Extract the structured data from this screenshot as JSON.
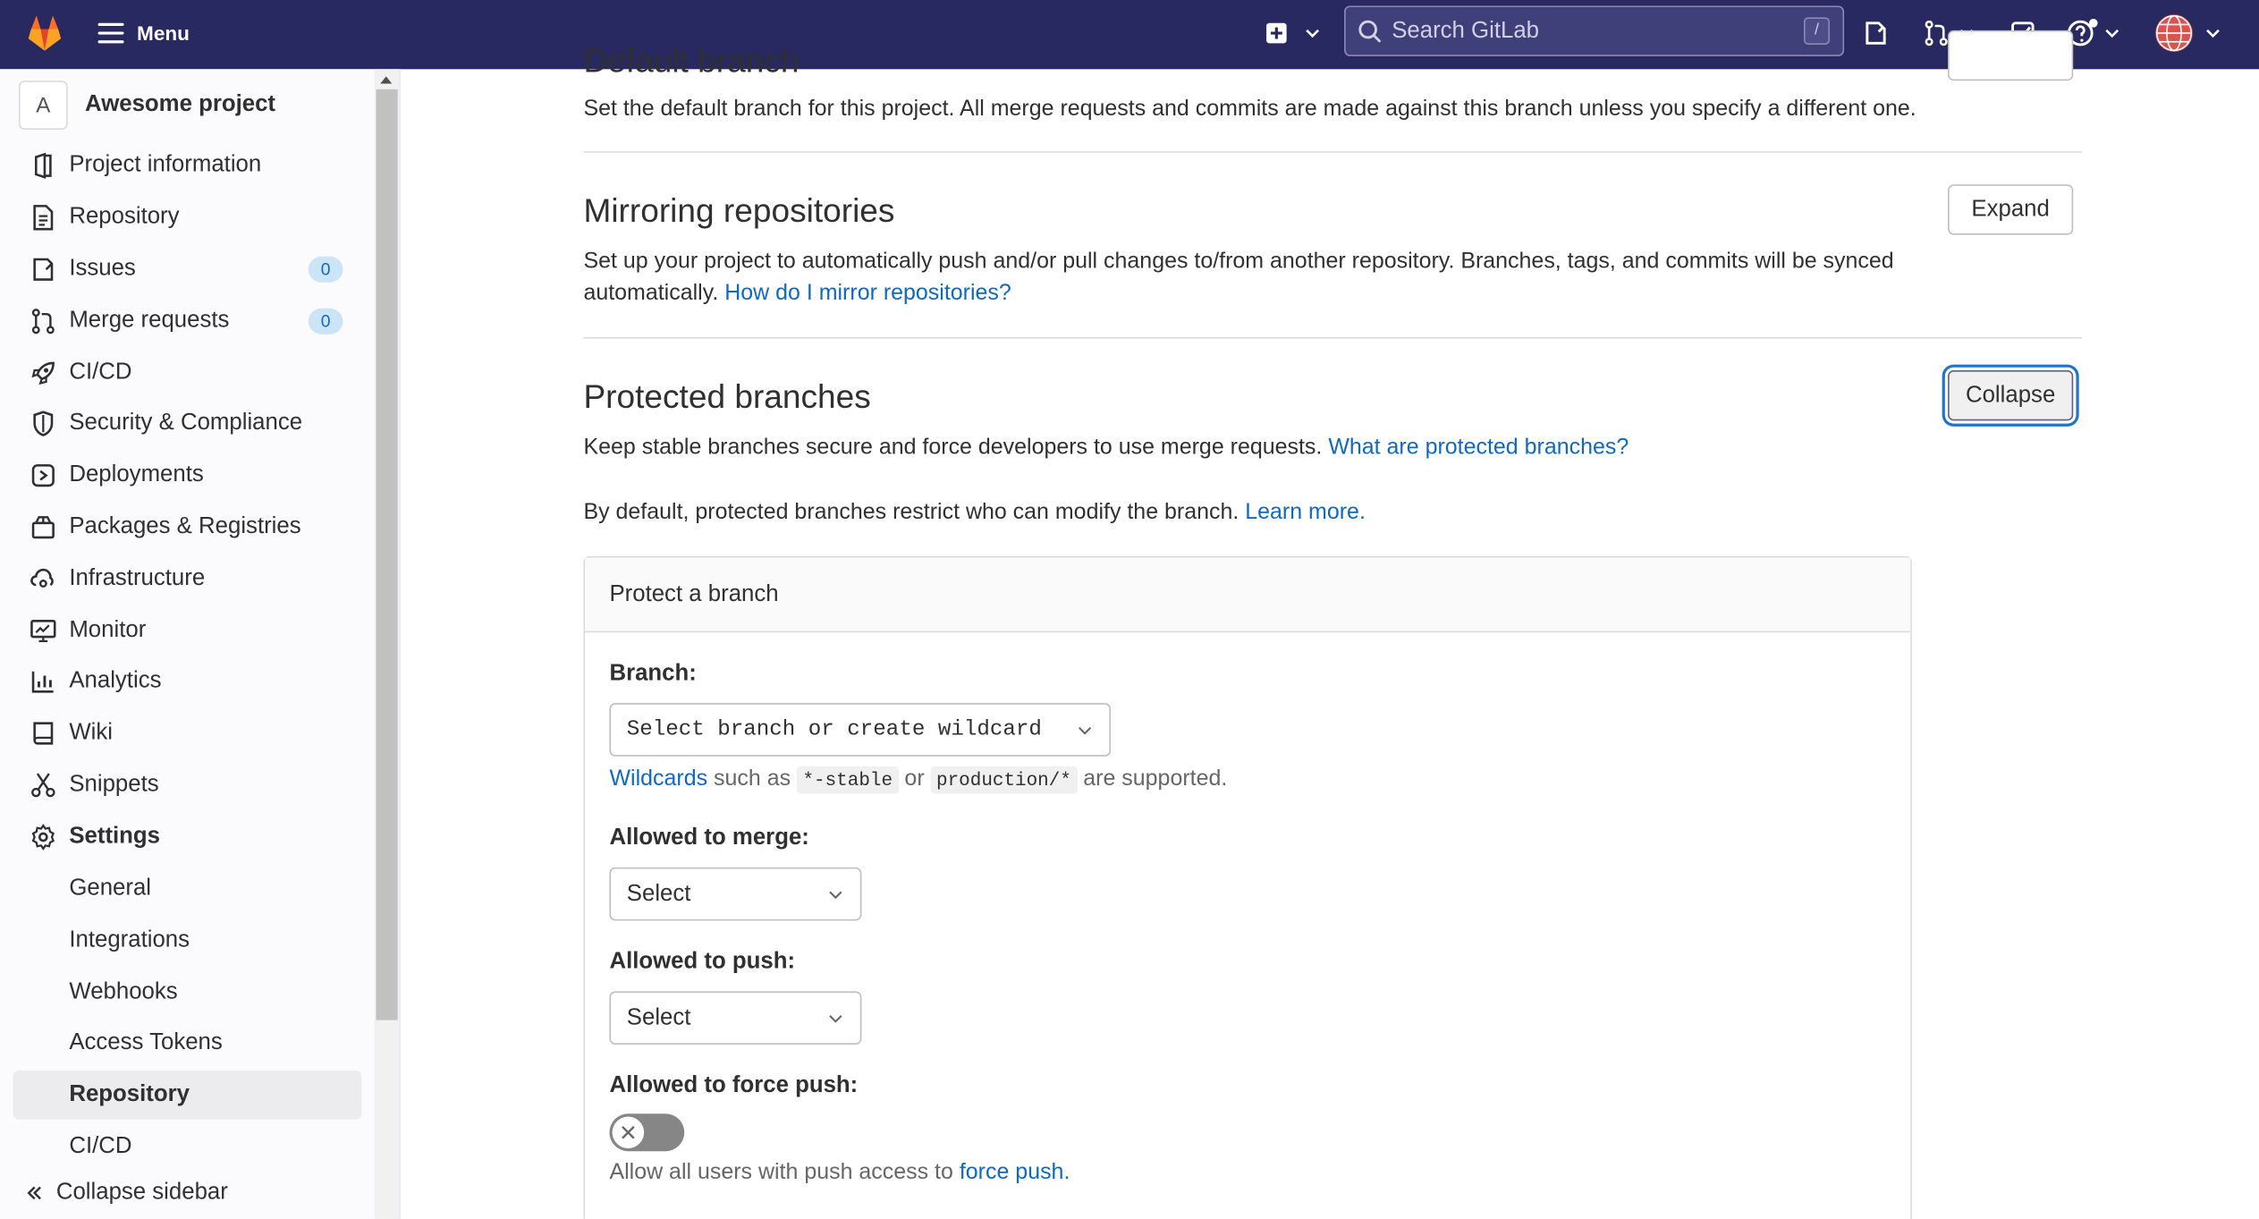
{
  "topbar": {
    "menu_label": "Menu",
    "search_placeholder": "Search GitLab",
    "search_shortcut": "/",
    "icons": [
      "gitlab-logo-icon",
      "plus-square-icon",
      "chevron-down-icon",
      "search-icon",
      "issues-icon",
      "merge-requests-icon",
      "todo-check-icon",
      "help-icon",
      "user-avatar-icon"
    ]
  },
  "sidebar": {
    "project_initial": "A",
    "project_name": "Awesome project",
    "items": [
      {
        "label": "Project information",
        "icon": "project-info-icon"
      },
      {
        "label": "Repository",
        "icon": "repository-doc-icon"
      },
      {
        "label": "Issues",
        "icon": "issues-icon",
        "badge": "0"
      },
      {
        "label": "Merge requests",
        "icon": "merge-request-icon",
        "badge": "0"
      },
      {
        "label": "CI/CD",
        "icon": "rocket-icon"
      },
      {
        "label": "Security & Compliance",
        "icon": "shield-icon"
      },
      {
        "label": "Deployments",
        "icon": "deployments-icon"
      },
      {
        "label": "Packages & Registries",
        "icon": "package-icon"
      },
      {
        "label": "Infrastructure",
        "icon": "cloud-icon"
      },
      {
        "label": "Monitor",
        "icon": "monitor-icon"
      },
      {
        "label": "Analytics",
        "icon": "chart-icon"
      },
      {
        "label": "Wiki",
        "icon": "book-icon"
      },
      {
        "label": "Snippets",
        "icon": "scissors-icon"
      },
      {
        "label": "Settings",
        "icon": "gear-icon"
      }
    ],
    "settings_sub": [
      "General",
      "Integrations",
      "Webhooks",
      "Access Tokens",
      "Repository",
      "CI/CD"
    ],
    "active_sub": "Repository",
    "collapse_label": "Collapse sidebar"
  },
  "main": {
    "default_branch": {
      "title": "Default branch",
      "text": "Set the default branch for this project. All merge requests and commits are made against this branch unless you specify a different one."
    },
    "mirroring": {
      "title": "Mirroring repositories",
      "text": "Set up your project to automatically push and/or pull changes to/from another repository. Branches, tags, and commits will be synced automatically.",
      "link": "How do I mirror repositories?",
      "button": "Expand"
    },
    "protected": {
      "title": "Protected branches",
      "text": "Keep stable branches secure and force developers to use merge requests.",
      "link": "What are protected branches?",
      "text2": "By default, protected branches restrict who can modify the branch.",
      "link2": "Learn more.",
      "button": "Collapse"
    },
    "card": {
      "header": "Protect a branch",
      "branch_label": "Branch:",
      "branch_placeholder": "Select branch or create wildcard",
      "wildcards_link": "Wildcards",
      "wildcards_text1": "such as",
      "wildcard_example1": "*-stable",
      "wildcards_or": "or",
      "wildcard_example2": "production/*",
      "wildcards_text2": "are supported.",
      "merge_label": "Allowed to merge:",
      "merge_value": "Select",
      "push_label": "Allowed to push:",
      "push_value": "Select",
      "force_label": "Allowed to force push:",
      "force_enabled": false,
      "force_help": "Allow all users with push access to",
      "force_link": "force push."
    }
  },
  "colors": {
    "topbar": "#292961",
    "link": "#1068bf",
    "badge_bg": "#cce5f6",
    "focus_ring": "#1f75cb"
  }
}
